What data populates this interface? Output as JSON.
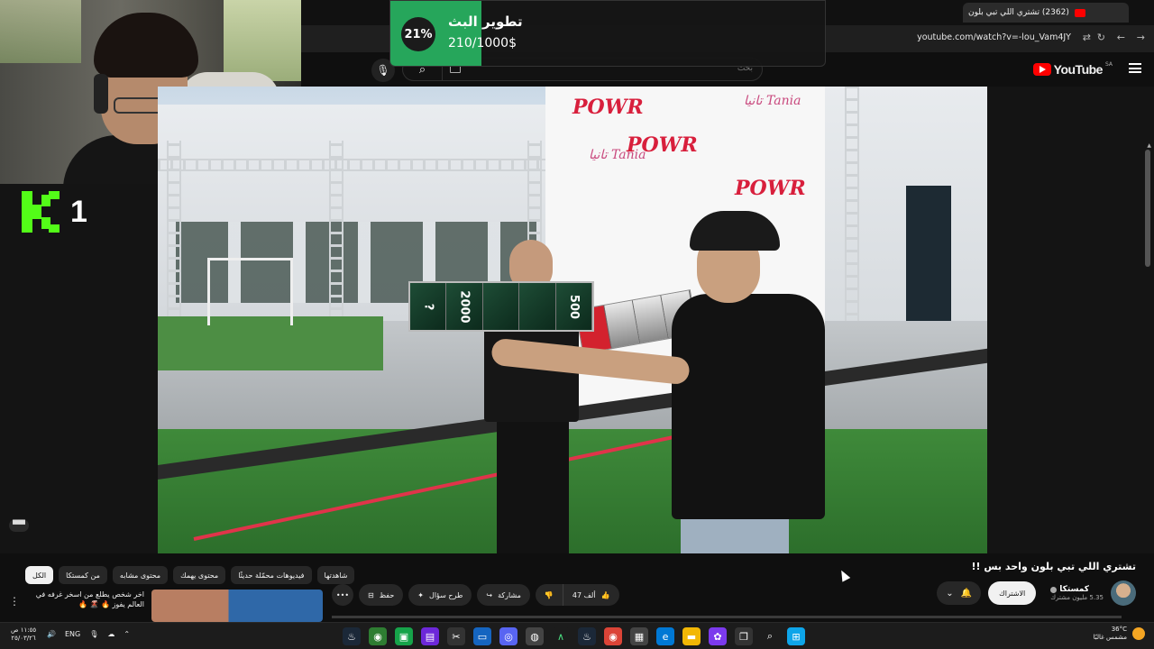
{
  "browser": {
    "tab_title": "(2362) تشتري اللي تبي بلون",
    "url": "youtube.com/watch?v=-lou_Vam4JY"
  },
  "youtube": {
    "search_placeholder": "بحث",
    "logo_text": "YouTube",
    "region": "SA"
  },
  "overlay": {
    "goal_title": "تطوير البث",
    "goal_amount": "210/1000$",
    "goal_percent_label": "21%",
    "goal_progress": 0.21,
    "kick_viewers": "1"
  },
  "video": {
    "card_values": [
      "?",
      "2000",
      "",
      "",
      "500"
    ],
    "brand_text": "POWR",
    "brand_text2": "تانيا Tania"
  },
  "info": {
    "title": "تشتري اللي تبي بلون واحد بس !!",
    "channel_name": "كمستكا",
    "channel_subs": "5.35 مليون مشترك",
    "subscribe_label": "الاشتراك",
    "like_count": "47 ألف",
    "share_label": "مشاركة",
    "ask_label": "طرح سؤال",
    "save_label": "حفظ",
    "chips": [
      "الكل",
      "من كمستكا",
      "محتوى مشابه",
      "محتوى يهمك",
      "فيديوهات محمّلة حديثًا",
      "شاهدتها"
    ],
    "recommendation_title": "اخر شخص يطلع من اسخر غرفه في العالم يفوز 🔥 🌋 🔥"
  },
  "taskbar": {
    "time": "١١:٥٥ ص",
    "date": "٢٥/٠٣/٢٦",
    "language": "ENG",
    "temperature": "36°C",
    "weather": "مشمس غالبًا"
  }
}
